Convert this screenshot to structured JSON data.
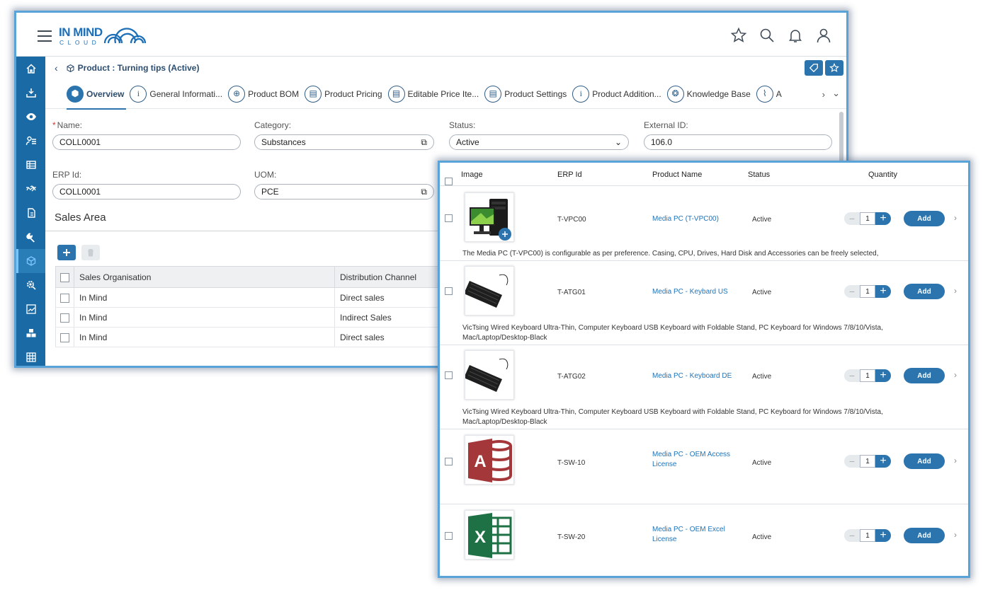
{
  "app": {
    "logo_line1": "IN MIND",
    "logo_line2": "CLOUD"
  },
  "header_icons": [
    "star-icon",
    "search-icon",
    "bell-icon",
    "user-icon"
  ],
  "sidebar": {
    "items": [
      "home-icon",
      "download-icon",
      "eye-icon",
      "user-list-icon",
      "table-icon",
      "handshake-icon",
      "document-icon",
      "wrench-icon",
      "cube-icon",
      "gear-search-icon",
      "chart-icon",
      "cubes-icon",
      "grid-icon"
    ],
    "active_index": 8
  },
  "breadcrumb": {
    "back": "‹",
    "title": "Product : Turning tips (Active)"
  },
  "tabs": [
    {
      "label": "Overview",
      "icon": "cube-icon",
      "active": true
    },
    {
      "label": "General Informati...",
      "icon": "info-icon"
    },
    {
      "label": "Product BOM",
      "icon": "box-plus-icon"
    },
    {
      "label": "Product Pricing",
      "icon": "price-icon"
    },
    {
      "label": "Editable Price Ite...",
      "icon": "price-edit-icon"
    },
    {
      "label": "Product Settings",
      "icon": "settings-doc-icon"
    },
    {
      "label": "Product Addition...",
      "icon": "info-icon"
    },
    {
      "label": "Knowledge Base",
      "icon": "knowledge-icon"
    },
    {
      "label": "A",
      "icon": "attachment-icon"
    }
  ],
  "form": {
    "name_label": "Name:",
    "name_required": "*",
    "name_value": "COLL0001",
    "category_label": "Category:",
    "category_value": "Substances",
    "status_label": "Status:",
    "status_value": "Active",
    "external_label": "External ID:",
    "external_value": "106.0",
    "erp_label": "ERP Id:",
    "erp_value": "COLL0001",
    "uom_label": "UOM:",
    "uom_value": "PCE"
  },
  "sales_area": {
    "title": "Sales Area",
    "columns": [
      "Sales Organisation",
      "Distribution Channel"
    ],
    "rows": [
      {
        "org": "In Mind",
        "channel": "Direct sales"
      },
      {
        "org": "In Mind",
        "channel": "Indirect Sales"
      },
      {
        "org": "In Mind",
        "channel": "Direct sales"
      }
    ]
  },
  "products": {
    "columns": {
      "image": "Image",
      "erp": "ERP Id",
      "name": "Product Name",
      "status": "Status",
      "qty": "Quantity"
    },
    "add_label": "Add",
    "minus": "−",
    "plus": "+",
    "rows": [
      {
        "erp": "T-VPC00",
        "name": "Media PC (T-VPC00)",
        "status": "Active",
        "qty": "1",
        "image": "desktop-pc-image",
        "desc": "The Media PC (T-VPC00) is configurable as per preference. Casing, CPU, Drives, Hard Disk and Accessories can be freely selected,"
      },
      {
        "erp": "T-ATG01",
        "name": "Media PC - Keybard US",
        "status": "Active",
        "qty": "1",
        "image": "keyboard-image",
        "desc": "VicTsing Wired Keyboard Ultra-Thin, Computer Keyboard USB Keyboard with Foldable Stand, PC Keyboard for Windows 7/8/10/Vista, Mac/Laptop/Desktop-Black"
      },
      {
        "erp": "T-ATG02",
        "name": "Media PC - Keyboard DE",
        "status": "Active",
        "qty": "1",
        "image": "keyboard-image",
        "desc": "VicTsing Wired Keyboard Ultra-Thin, Computer Keyboard USB Keyboard with Foldable Stand, PC Keyboard for Windows 7/8/10/Vista, Mac/Laptop/Desktop-Black"
      },
      {
        "erp": "T-SW-10",
        "name": "Media PC - OEM Access License",
        "status": "Active",
        "qty": "1",
        "image": "access-logo-image",
        "desc": ""
      },
      {
        "erp": "T-SW-20",
        "name": "Media PC - OEM Excel License",
        "status": "Active",
        "qty": "1",
        "image": "excel-logo-image",
        "desc": ""
      }
    ]
  },
  "colors": {
    "primary": "#2b74ae",
    "sidebar": "#1a6ba5",
    "link": "#1f73b8",
    "frame": "#5aa3d8",
    "access": "#a4373a",
    "excel": "#1e7145"
  }
}
